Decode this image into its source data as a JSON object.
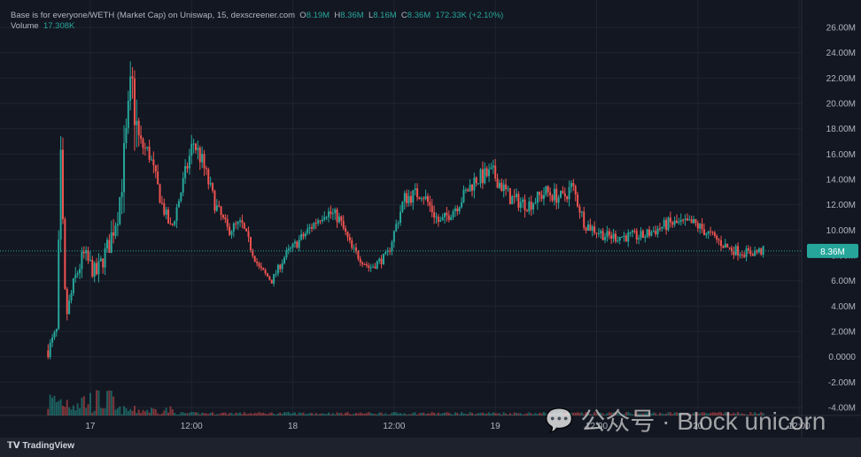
{
  "legend": {
    "title": "Base is for everyone/WETH (Market Cap) on Uniswap, 15, dexscreener.com",
    "o_label": "O",
    "o": "8.19M",
    "h_label": "H",
    "h": "8.36M",
    "l_label": "L",
    "l": "8.16M",
    "c_label": "C",
    "c": "8.36M",
    "change": "172.33K (+2.10%)",
    "volume_label": "Volume",
    "volume": "17.308K"
  },
  "price_label": "8.36M",
  "watermark": "公众号 · Block unicorn",
  "branding": "TradingView",
  "colors": {
    "up": "#26a69a",
    "down": "#ef5350",
    "bg": "#131722"
  },
  "chart_data": {
    "type": "candlestick",
    "title": "Base is for everyone/WETH (Market Cap)",
    "interval_minutes": 15,
    "ylabel": "Market Cap",
    "ylim": [
      -4,
      26
    ],
    "y_ticks": [
      "26.00M",
      "24.00M",
      "22.00M",
      "20.00M",
      "18.00M",
      "16.00M",
      "14.00M",
      "12.00M",
      "10.00M",
      "8.00M",
      "6.00M",
      "4.00M",
      "2.00M",
      "0.0000",
      "-2.00M",
      "-4.00M"
    ],
    "x_ticks": [
      {
        "label": "17",
        "hour": 0
      },
      {
        "label": "12:00",
        "hour": 12
      },
      {
        "label": "18",
        "hour": 24
      },
      {
        "label": "12:00",
        "hour": 36
      },
      {
        "label": "19",
        "hour": 48
      },
      {
        "label": "12:00",
        "hour": 60
      },
      {
        "label": "20",
        "hour": 72
      },
      {
        "label": "12:00",
        "hour": 84
      }
    ],
    "x_hour_range": [
      -10.7,
      84.3
    ],
    "approx_path": {
      "hour": [
        -5,
        -4,
        -3.5,
        -2.9,
        -1.9,
        -0.8,
        0.7,
        2.3,
        3.4,
        4.4,
        4.9,
        5.7,
        7,
        8.5,
        9.6,
        11.1,
        12.2,
        13.2,
        14.8,
        16.3,
        17.9,
        20,
        21.5,
        23.1,
        25.2,
        27.8,
        29.4,
        31,
        33.1,
        35.2,
        37.2,
        39.3,
        41.4,
        43.5,
        45.6,
        47.7,
        49.8,
        51.9,
        54,
        56,
        57.1,
        58.6,
        61.2,
        63.3,
        65.4,
        68.5,
        71.6,
        73.7,
        75.8,
        77.9,
        79.8
      ],
      "value": [
        0.5,
        2,
        15,
        3,
        6,
        8,
        6.5,
        9,
        12,
        18,
        21.5,
        17,
        16,
        12,
        10,
        14,
        17,
        15.5,
        12,
        10,
        10.5,
        7,
        6,
        8,
        9.5,
        11.5,
        11,
        8.5,
        7,
        8,
        12.5,
        13,
        10.5,
        12,
        14,
        14.5,
        12.5,
        12,
        13,
        12.5,
        13.5,
        10.5,
        9.5,
        9.5,
        9.5,
        10.5,
        10.5,
        9.5,
        8.5,
        8.2,
        8.36
      ]
    }
  }
}
